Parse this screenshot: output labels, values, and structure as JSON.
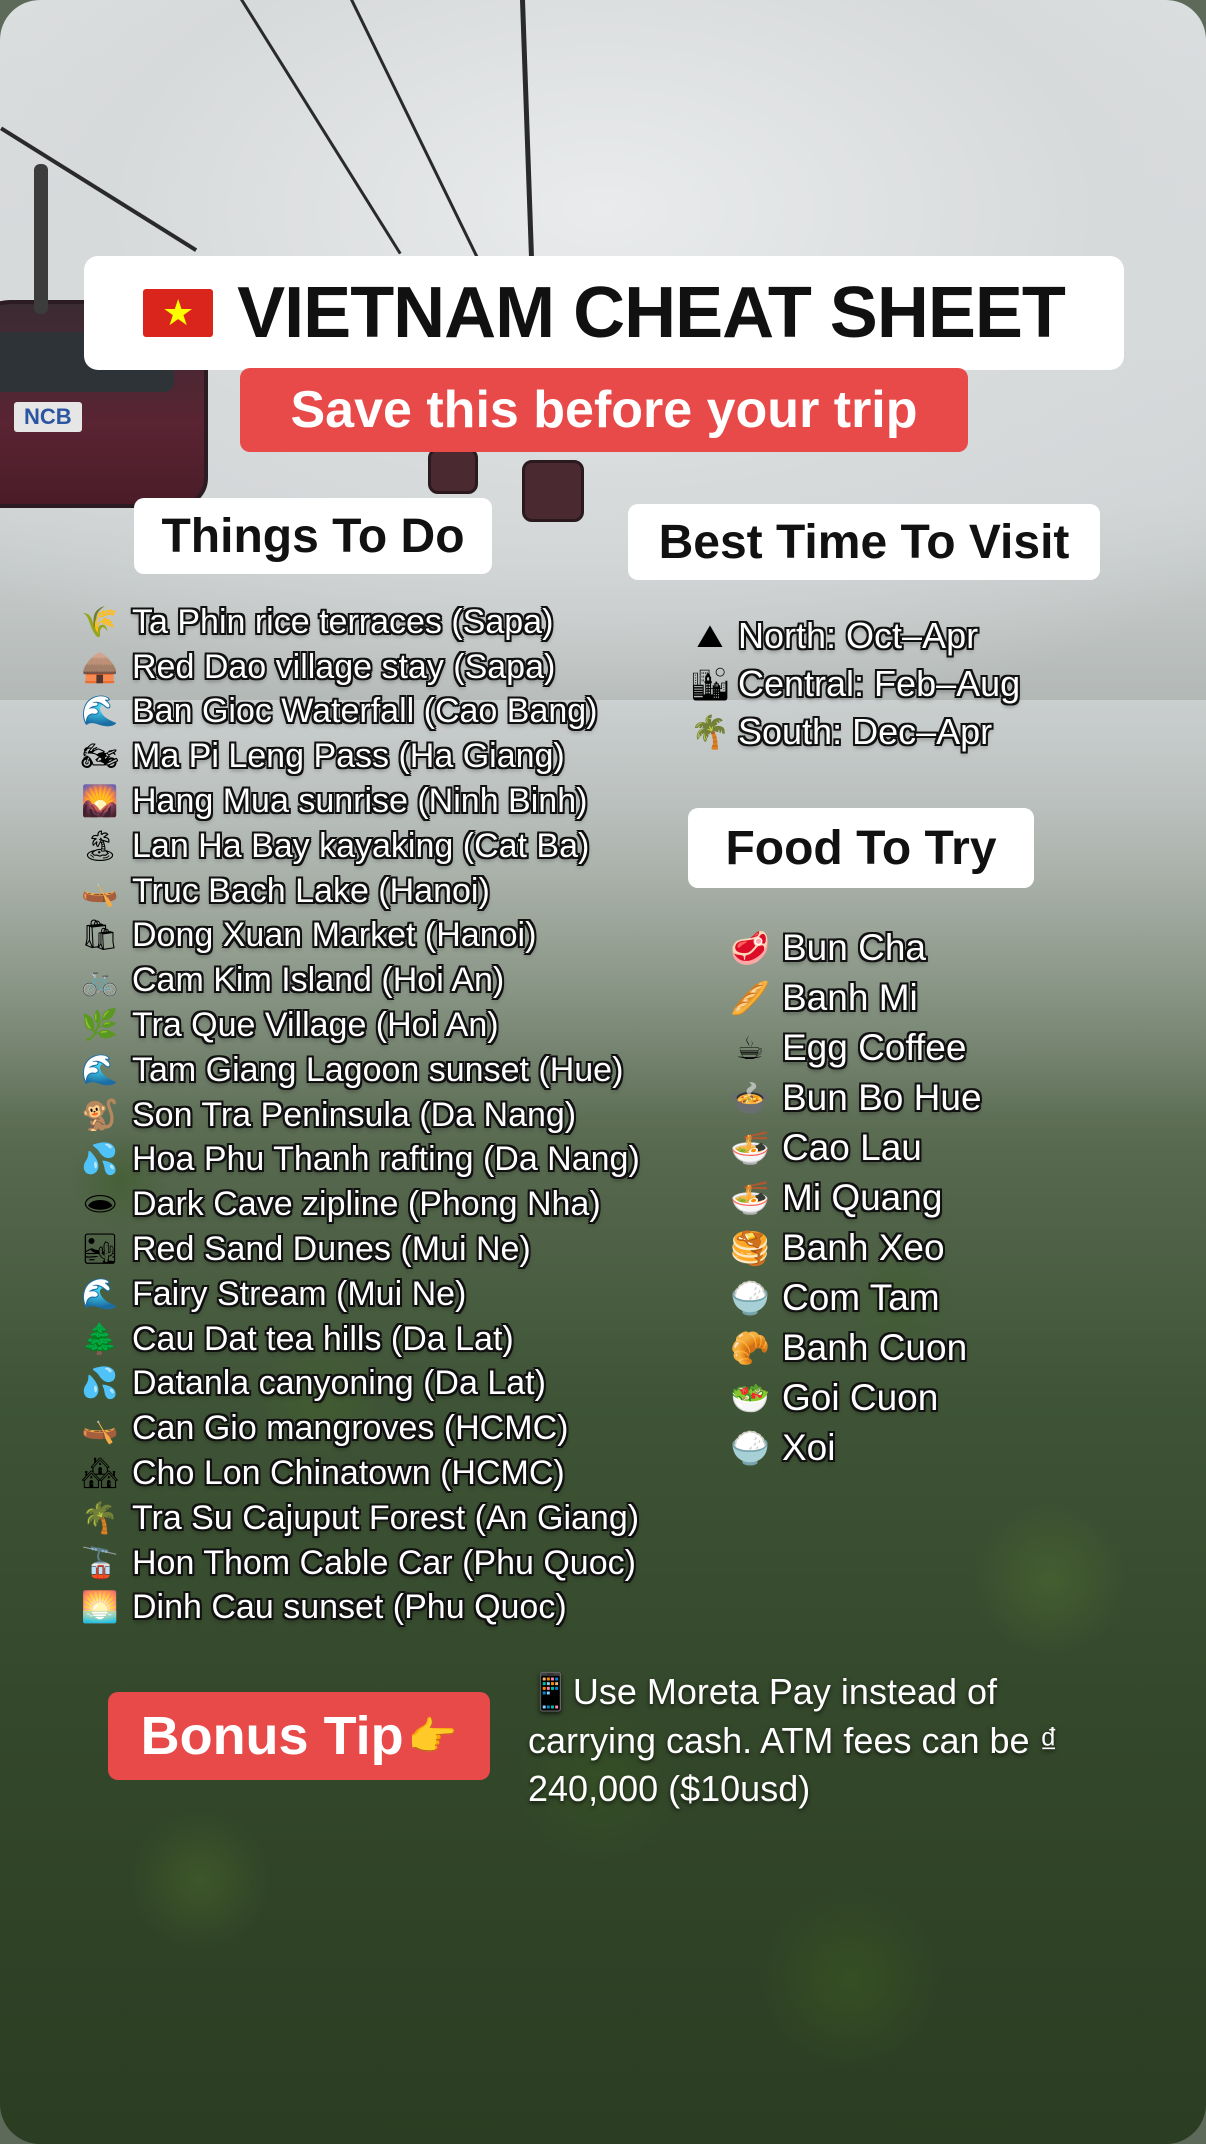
{
  "title": {
    "flag_icon": "vietnam-flag",
    "text": "VIETNAM CHEAT SHEET"
  },
  "subtitle": "Save this before your trip",
  "things_to_do": {
    "heading": "Things To Do",
    "items": [
      {
        "icon": "🌾",
        "icon_name": "rice-icon",
        "text": "Ta Phin rice terraces (Sapa)"
      },
      {
        "icon": "🛖",
        "icon_name": "hut-icon",
        "text": "Red Dao village stay (Sapa)"
      },
      {
        "icon": "🌊",
        "icon_name": "wave-icon",
        "text": "Ban Gioc Waterfall (Cao Bang)"
      },
      {
        "icon": "🏍",
        "icon_name": "motorbike-icon",
        "text": "Ma Pi Leng Pass (Ha Giang)"
      },
      {
        "icon": "🌄",
        "icon_name": "sunrise-icon",
        "text": "Hang Mua sunrise (Ninh Binh)"
      },
      {
        "icon": "🏝",
        "icon_name": "island-icon",
        "text": "Lan Ha Bay kayaking (Cat Ba)"
      },
      {
        "icon": "🛶",
        "icon_name": "canoe-icon",
        "text": "Truc Bach Lake (Hanoi)"
      },
      {
        "icon": "🛍",
        "icon_name": "shopping-bags-icon",
        "text": "Dong Xuan Market (Hanoi)"
      },
      {
        "icon": "🚲",
        "icon_name": "bicycle-icon",
        "text": "Cam Kim Island (Hoi An)"
      },
      {
        "icon": "🌿",
        "icon_name": "herb-icon",
        "text": "Tra Que Village (Hoi An)"
      },
      {
        "icon": "🌊",
        "icon_name": "wave-icon",
        "text": "Tam Giang Lagoon sunset (Hue)"
      },
      {
        "icon": "🐒",
        "icon_name": "monkey-icon",
        "text": "Son Tra Peninsula (Da Nang)"
      },
      {
        "icon": "💦",
        "icon_name": "splash-icon",
        "text": "Hoa Phu Thanh rafting (Da Nang)"
      },
      {
        "icon": "🕳",
        "icon_name": "hole-icon",
        "text": "Dark Cave zipline (Phong Nha)"
      },
      {
        "icon": "🏜",
        "icon_name": "desert-icon",
        "text": "Red Sand Dunes (Mui Ne)"
      },
      {
        "icon": "🌊",
        "icon_name": "wave-icon",
        "text": "Fairy Stream (Mui Ne)"
      },
      {
        "icon": "🌲",
        "icon_name": "evergreen-tree-icon",
        "text": "Cau Dat tea hills (Da Lat)"
      },
      {
        "icon": "💦",
        "icon_name": "splash-icon",
        "text": "Datanla canyoning (Da Lat)"
      },
      {
        "icon": "🛶",
        "icon_name": "canoe-icon",
        "text": "Can Gio mangroves (HCMC)"
      },
      {
        "icon": "🏘",
        "icon_name": "houses-icon",
        "text": "Cho Lon Chinatown (HCMC)"
      },
      {
        "icon": "🌴",
        "icon_name": "palm-tree-icon",
        "text": "Tra Su Cajuput Forest (An Giang)"
      },
      {
        "icon": "🚡",
        "icon_name": "cable-car-icon",
        "text": "Hon Thom Cable Car (Phu Quoc)"
      },
      {
        "icon": "🌅",
        "icon_name": "sunset-icon",
        "text": "Dinh Cau sunset (Phu Quoc)"
      }
    ]
  },
  "best_time": {
    "heading": "Best Time To Visit",
    "items": [
      {
        "icon": "⛰",
        "icon_name": "mountain-icon",
        "text": "North: Oct–Apr"
      },
      {
        "icon": "🏙",
        "icon_name": "city-icon",
        "text": "Central: Feb–Aug"
      },
      {
        "icon": "🌴",
        "icon_name": "palm-tree-icon",
        "text": "South: Dec–Apr"
      }
    ]
  },
  "food": {
    "heading": "Food To Try",
    "items": [
      {
        "icon": "🥩",
        "icon_name": "meat-icon",
        "text": "Bun Cha"
      },
      {
        "icon": "🥖",
        "icon_name": "baguette-icon",
        "text": "Banh Mi"
      },
      {
        "icon": "☕",
        "icon_name": "coffee-icon",
        "text": "Egg Coffee"
      },
      {
        "icon": "🍲",
        "icon_name": "soup-icon",
        "text": "Bun Bo Hue"
      },
      {
        "icon": "🍜",
        "icon_name": "noodles-icon",
        "text": "Cao Lau"
      },
      {
        "icon": "🍜",
        "icon_name": "noodles-icon",
        "text": "Mi Quang"
      },
      {
        "icon": "🥞",
        "icon_name": "pancake-icon",
        "text": "Banh Xeo"
      },
      {
        "icon": "🍚",
        "icon_name": "rice-bowl-icon",
        "text": "Com Tam"
      },
      {
        "icon": "🥐",
        "icon_name": "roll-icon",
        "text": "Banh Cuon"
      },
      {
        "icon": "🥗",
        "icon_name": "salad-icon",
        "text": "Goi Cuon"
      },
      {
        "icon": "🍚",
        "icon_name": "rice-bowl-icon",
        "text": "Xoi"
      }
    ]
  },
  "bonus": {
    "label": "Bonus Tip",
    "pointer_icon": "👉",
    "tip_icon": "📱",
    "tip_text": "Use Moreta Pay instead of carrying cash. ATM fees can be ₫ 240,000 ($10usd)"
  },
  "colors": {
    "accent_red": "#e84a4a",
    "label_white": "#ffffff",
    "flag_red": "#da251d",
    "flag_star": "#ffff00"
  }
}
